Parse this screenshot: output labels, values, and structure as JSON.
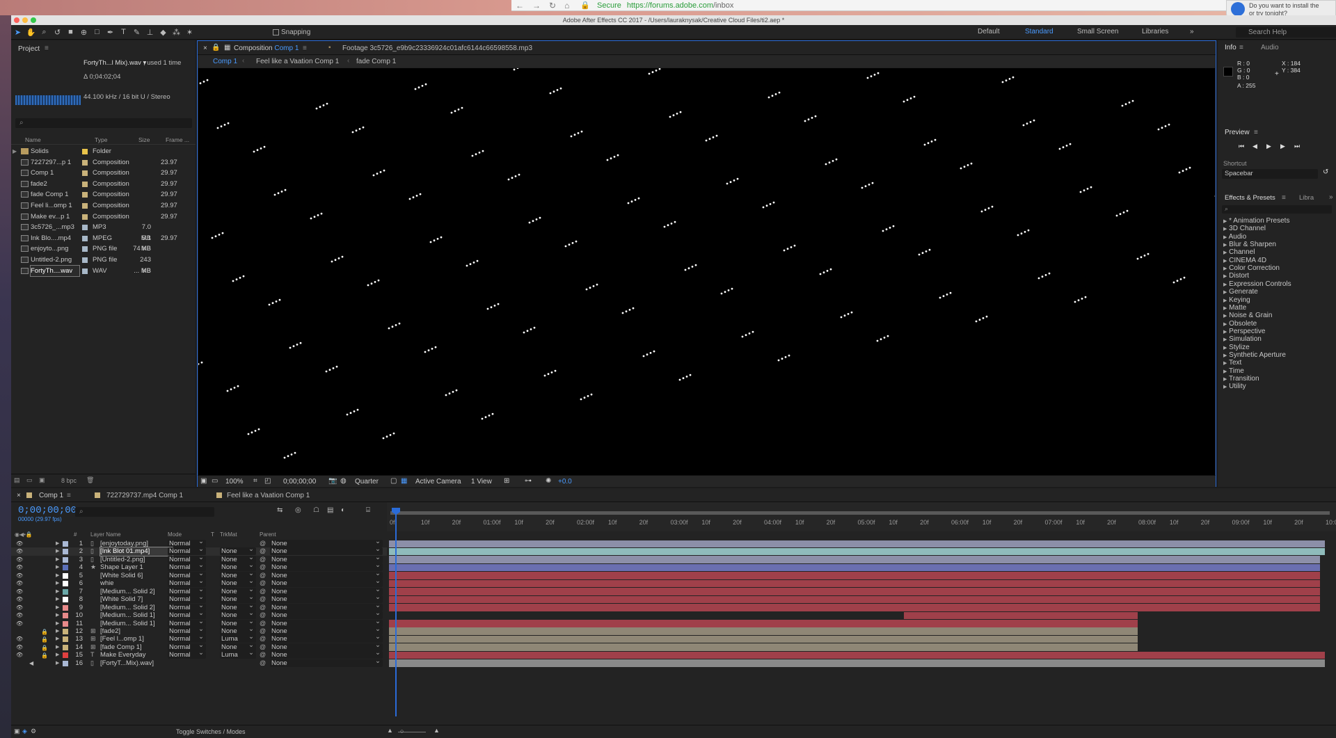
{
  "browser": {
    "secure": "Secure",
    "url_host": "https://forums.adobe.com",
    "url_path": "/inbox"
  },
  "notification": {
    "line1": "Do you want to install the",
    "line2": "or try tonight?"
  },
  "window_title": "Adobe After Effects CC 2017 - /Users/lauraknysak/Creative Cloud Files/ti2.aep *",
  "toolbar": {
    "snapping": "Snapping",
    "workspaces": [
      "Default",
      "Standard",
      "Small Screen",
      "Libraries"
    ],
    "selected_workspace": "Standard",
    "search_help": "Search Help"
  },
  "project": {
    "title": "Project",
    "selected_name": "FortyTh...l Mix).wav ▾",
    "used": ", used 1 time",
    "duration": "Δ 0;04:02;04",
    "audio_info": "44.100 kHz / 16 bit U / Stereo",
    "columns": [
      "Name",
      "Type",
      "Size",
      "Frame ..."
    ],
    "items": [
      {
        "name": "Solids",
        "type": "Folder",
        "size": "",
        "fps": "",
        "color": "#e8c34a",
        "icon": "folder-icon"
      },
      {
        "name": "7227297...p 1",
        "type": "Composition",
        "size": "",
        "fps": "23.97",
        "color": "#c9b27a",
        "icon": "composition-icon"
      },
      {
        "name": "Comp 1",
        "type": "Composition",
        "size": "",
        "fps": "29.97",
        "color": "#c9b27a",
        "icon": "composition-icon"
      },
      {
        "name": "fade2",
        "type": "Composition",
        "size": "",
        "fps": "29.97",
        "color": "#c9b27a",
        "icon": "composition-icon"
      },
      {
        "name": "fade Comp 1",
        "type": "Composition",
        "size": "",
        "fps": "29.97",
        "color": "#c9b27a",
        "icon": "composition-icon"
      },
      {
        "name": "Feel li...omp 1",
        "type": "Composition",
        "size": "",
        "fps": "29.97",
        "color": "#c9b27a",
        "icon": "composition-icon"
      },
      {
        "name": "Make ev...p 1",
        "type": "Composition",
        "size": "",
        "fps": "29.97",
        "color": "#c9b27a",
        "icon": "composition-icon"
      },
      {
        "name": "3c5726_...mp3",
        "type": "MP3",
        "size": "7.0 MB",
        "fps": "",
        "color": "#a8b8c8",
        "icon": "file-icon"
      },
      {
        "name": "Ink Blo....mp4",
        "type": "MPEG",
        "size": "5.1 MB",
        "fps": "29.97",
        "color": "#a8b8c8",
        "icon": "file-icon"
      },
      {
        "name": "enjoyto...png",
        "type": "PNG file",
        "size": "74 KB",
        "fps": "",
        "color": "#a8b8c8",
        "icon": "file-icon"
      },
      {
        "name": "Untitled-2.png",
        "type": "PNG file",
        "size": "243 KB",
        "fps": "",
        "color": "#a8b8c8",
        "icon": "file-icon"
      },
      {
        "name": "FortyTh....wav",
        "type": "WAV",
        "size": "... MB",
        "fps": "",
        "color": "#a8b8c8",
        "icon": "file-icon"
      }
    ],
    "bpc": "8 bpc"
  },
  "composition": {
    "tab_label": "Composition",
    "tab_name": "Comp 1",
    "footage_tab": "Footage 3c5726_e9b9c23336924c01afc6144c66598558.mp3",
    "breadcrumbs": [
      "Comp 1",
      "Feel like a Vaation Comp 1",
      "fade Comp 1"
    ],
    "zoom": "100%",
    "timecode": "0;00;00;00",
    "resolution": "Quarter",
    "camera": "Active Camera",
    "views": "1 View",
    "exposure": "+0.0"
  },
  "right_panel": {
    "info_tab": "Info",
    "audio_tab": "Audio",
    "rgb": [
      "R : 0",
      "G : 0",
      "B : 0",
      "A : 255"
    ],
    "xy": [
      "X : 184",
      "Y : 384"
    ],
    "preview": "Preview",
    "shortcut_label": "Shortcut",
    "shortcut": "Spacebar",
    "effects_tab": "Effects & Presets",
    "libraries_tab": "Libra",
    "effects": [
      "* Animation Presets",
      "3D Channel",
      "Audio",
      "Blur & Sharpen",
      "Channel",
      "CINEMA 4D",
      "Color Correction",
      "Distort",
      "Expression Controls",
      "Generate",
      "Keying",
      "Matte",
      "Noise & Grain",
      "Obsolete",
      "Perspective",
      "Simulation",
      "Stylize",
      "Synthetic Aperture",
      "Text",
      "Time",
      "Transition",
      "Utility"
    ]
  },
  "timeline": {
    "tabs": [
      "Comp 1",
      "722729737.mp4 Comp 1",
      "Feel like a Vaation Comp 1"
    ],
    "timecode": "0;00;00;00",
    "fps": "00000 (29.97 fps)",
    "columns": [
      "#",
      "Layer Name",
      "Mode",
      "T",
      "TrkMat",
      "Parent"
    ],
    "ruler": [
      "0f",
      "10f",
      "20f",
      "01:00f",
      "10f",
      "20f",
      "02:00f",
      "10f",
      "20f",
      "03:00f",
      "10f",
      "20f",
      "04:00f",
      "10f",
      "20f",
      "05:00f",
      "10f",
      "20f",
      "06:00f",
      "10f",
      "20f",
      "07:00f",
      "10f",
      "20f",
      "08:00f",
      "10f",
      "20f",
      "09:00f",
      "10f",
      "20f",
      "10:0"
    ],
    "layers": [
      {
        "num": "1",
        "name": "[enjoytoday.png]",
        "icon": "file",
        "mode": "Normal",
        "trkmat": "",
        "parent": "None",
        "color": "#a9b8d4",
        "bar": "#8c8fa8",
        "start": 0,
        "end": 1,
        "lock": false,
        "eye": true,
        "sel": false
      },
      {
        "num": "2",
        "name": "[Ink Blot 01.mp4]",
        "icon": "file",
        "mode": "Normal",
        "trkmat": "None",
        "parent": "None",
        "color": "#a9b8d4",
        "bar": "#8fbbbb",
        "start": 0,
        "end": 1,
        "lock": false,
        "eye": true,
        "sel": true
      },
      {
        "num": "3",
        "name": "[Untitled-2.png]",
        "icon": "file",
        "mode": "Normal",
        "trkmat": "None",
        "parent": "None",
        "color": "#a9b8d4",
        "bar": "#8c8fa8",
        "start": 0,
        "end": 0.995,
        "lock": false,
        "eye": true,
        "sel": false
      },
      {
        "num": "4",
        "name": "Shape Layer 1",
        "icon": "star",
        "mode": "Normal",
        "trkmat": "None",
        "parent": "None",
        "color": "#5a6fb8",
        "bar": "#6a6fb0",
        "start": 0,
        "end": 0.995,
        "lock": false,
        "eye": true,
        "sel": false
      },
      {
        "num": "5",
        "name": "[White Solid 6]",
        "icon": "solid",
        "mode": "Normal",
        "trkmat": "None",
        "parent": "None",
        "color": "#ffffff",
        "bar": "#a0404a",
        "start": 0,
        "end": 0.995,
        "lock": false,
        "eye": true,
        "sel": false
      },
      {
        "num": "6",
        "name": "whie",
        "icon": "solid",
        "mode": "Normal",
        "trkmat": "None",
        "parent": "None",
        "color": "#ffffff",
        "bar": "#a0404a",
        "start": 0,
        "end": 0.995,
        "lock": false,
        "eye": true,
        "sel": false
      },
      {
        "num": "7",
        "name": "[Medium... Solid 2]",
        "icon": "solid",
        "mode": "Normal",
        "trkmat": "None",
        "parent": "None",
        "color": "#6aa8a8",
        "bar": "#a0404a",
        "start": 0,
        "end": 0.995,
        "lock": false,
        "eye": true,
        "sel": false
      },
      {
        "num": "8",
        "name": "[White Solid 7]",
        "icon": "solid",
        "mode": "Normal",
        "trkmat": "None",
        "parent": "None",
        "color": "#ffffff",
        "bar": "#a0404a",
        "start": 0,
        "end": 0.995,
        "lock": false,
        "eye": true,
        "sel": false
      },
      {
        "num": "9",
        "name": "[Medium... Solid 2]",
        "icon": "solid",
        "mode": "Normal",
        "trkmat": "None",
        "parent": "None",
        "color": "#e88a8a",
        "bar": "#a0404a",
        "start": 0,
        "end": 0.995,
        "lock": false,
        "eye": true,
        "sel": false
      },
      {
        "num": "10",
        "name": "[Medium... Solid 1]",
        "icon": "solid",
        "mode": "Normal",
        "trkmat": "None",
        "parent": "None",
        "color": "#e88a8a",
        "bar": "#a0404a",
        "start": 0.55,
        "end": 0.8,
        "lock": false,
        "eye": true,
        "sel": false
      },
      {
        "num": "11",
        "name": "[Medium... Solid 1]",
        "icon": "solid",
        "mode": "Normal",
        "trkmat": "None",
        "parent": "None",
        "color": "#e88a8a",
        "bar": "#a0404a",
        "start": 0,
        "end": 0.8,
        "lock": false,
        "eye": true,
        "sel": false
      },
      {
        "num": "12",
        "name": "[fade2]",
        "icon": "comp",
        "mode": "Normal",
        "trkmat": "None",
        "parent": "None",
        "color": "#c9b27a",
        "bar": "#8f8776",
        "start": 0,
        "end": 0.8,
        "lock": true,
        "eye": false,
        "sel": false
      },
      {
        "num": "13",
        "name": "[Feel l...omp 1]",
        "icon": "comp",
        "mode": "Normal",
        "trkmat": "Luma",
        "parent": "None",
        "color": "#c9b27a",
        "bar": "#8f8776",
        "start": 0,
        "end": 0.8,
        "lock": true,
        "eye": true,
        "sel": false
      },
      {
        "num": "14",
        "name": "[fade Comp 1]",
        "icon": "comp",
        "mode": "Normal",
        "trkmat": "None",
        "parent": "None",
        "color": "#c9b27a",
        "bar": "#8f8776",
        "start": 0,
        "end": 0.8,
        "lock": true,
        "eye": true,
        "sel": false
      },
      {
        "num": "15",
        "name": "Make Everyday",
        "icon": "text",
        "mode": "Normal",
        "trkmat": "Luma",
        "parent": "None",
        "color": "#e04040",
        "bar": "#a0404a",
        "start": 0,
        "end": 1,
        "lock": true,
        "eye": true,
        "sel": false
      },
      {
        "num": "16",
        "name": "[FortyT...Mix).wav]",
        "icon": "file",
        "mode": "",
        "trkmat": "",
        "parent": "None",
        "color": "#a9b8d4",
        "bar": "#8a8a8a",
        "start": 0,
        "end": 1,
        "lock": false,
        "eye": false,
        "sel": false
      }
    ],
    "toggle": "Toggle Switches / Modes"
  }
}
